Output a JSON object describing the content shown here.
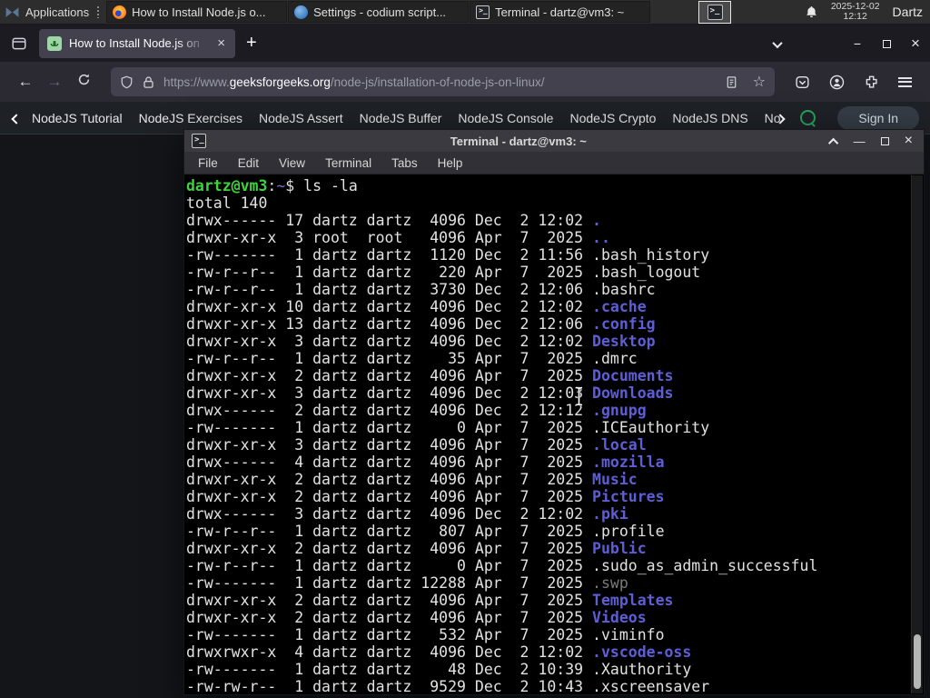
{
  "taskbar": {
    "applications_label": "Applications",
    "windows": [
      {
        "icon": "firefox",
        "title": "How to Install Node.js o..."
      },
      {
        "icon": "codium",
        "title": "Settings - codium script..."
      },
      {
        "icon": "terminal",
        "title": "Terminal - dartz@vm3: ~"
      }
    ],
    "clock": {
      "date": "2025-12-02",
      "time": "12:12"
    },
    "user": "Dartz"
  },
  "browser": {
    "tab": {
      "title": "How to Install Node.js on"
    },
    "new_tab_label": "+",
    "url": {
      "prefix": "https://www.",
      "domain": "geeksforgeeks.org",
      "path": "/node-js/installation-of-node-js-on-linux/"
    }
  },
  "site_nav": {
    "items": [
      "NodeJS Tutorial",
      "NodeJS Exercises",
      "NodeJS Assert",
      "NodeJS Buffer",
      "NodeJS Console",
      "NodeJS Crypto",
      "NodeJS DNS",
      "Node"
    ],
    "sign_in_label": "Sign In"
  },
  "terminal_window": {
    "title": "Terminal - dartz@vm3: ~",
    "menu_items": [
      "File",
      "Edit",
      "View",
      "Terminal",
      "Tabs",
      "Help"
    ],
    "prompt": {
      "user_host": "dartz@vm3",
      "separator": ":",
      "cwd": "~",
      "prompt_char": "$",
      "command": "ls -la"
    },
    "total_line": "total 140",
    "listing": [
      {
        "pre": "drwx------ 17 dartz dartz  4096 Dec  2 12:02 ",
        "name": ".",
        "type": "dir"
      },
      {
        "pre": "drwxr-xr-x  3 root  root   4096 Apr  7  2025 ",
        "name": "..",
        "type": "dir"
      },
      {
        "pre": "-rw-------  1 dartz dartz  1120 Dec  2 11:56 ",
        "name": ".bash_history",
        "type": "file"
      },
      {
        "pre": "-rw-r--r--  1 dartz dartz   220 Apr  7  2025 ",
        "name": ".bash_logout",
        "type": "file"
      },
      {
        "pre": "-rw-r--r--  1 dartz dartz  3730 Dec  2 12:06 ",
        "name": ".bashrc",
        "type": "file"
      },
      {
        "pre": "drwxr-xr-x 10 dartz dartz  4096 Dec  2 12:02 ",
        "name": ".cache",
        "type": "dir"
      },
      {
        "pre": "drwxr-xr-x 13 dartz dartz  4096 Dec  2 12:06 ",
        "name": ".config",
        "type": "dir"
      },
      {
        "pre": "drwxr-xr-x  3 dartz dartz  4096 Dec  2 12:02 ",
        "name": "Desktop",
        "type": "dir"
      },
      {
        "pre": "-rw-r--r--  1 dartz dartz    35 Apr  7  2025 ",
        "name": ".dmrc",
        "type": "file"
      },
      {
        "pre": "drwxr-xr-x  2 dartz dartz  4096 Apr  7  2025 ",
        "name": "Documents",
        "type": "dir"
      },
      {
        "pre": "drwxr-xr-x  3 dartz dartz  4096 Dec  2 12:03 ",
        "name": "Downloads",
        "type": "dir"
      },
      {
        "pre": "drwx------  2 dartz dartz  4096 Dec  2 12:12 ",
        "name": ".gnupg",
        "type": "dir"
      },
      {
        "pre": "-rw-------  1 dartz dartz     0 Apr  7  2025 ",
        "name": ".ICEauthority",
        "type": "file"
      },
      {
        "pre": "drwxr-xr-x  3 dartz dartz  4096 Apr  7  2025 ",
        "name": ".local",
        "type": "dir"
      },
      {
        "pre": "drwx------  4 dartz dartz  4096 Apr  7  2025 ",
        "name": ".mozilla",
        "type": "dir"
      },
      {
        "pre": "drwxr-xr-x  2 dartz dartz  4096 Apr  7  2025 ",
        "name": "Music",
        "type": "dir"
      },
      {
        "pre": "drwxr-xr-x  2 dartz dartz  4096 Apr  7  2025 ",
        "name": "Pictures",
        "type": "dir"
      },
      {
        "pre": "drwx------  3 dartz dartz  4096 Dec  2 12:02 ",
        "name": ".pki",
        "type": "dir"
      },
      {
        "pre": "-rw-r--r--  1 dartz dartz   807 Apr  7  2025 ",
        "name": ".profile",
        "type": "file"
      },
      {
        "pre": "drwxr-xr-x  2 dartz dartz  4096 Apr  7  2025 ",
        "name": "Public",
        "type": "dir"
      },
      {
        "pre": "-rw-r--r--  1 dartz dartz     0 Apr  7  2025 ",
        "name": ".sudo_as_admin_successful",
        "type": "file"
      },
      {
        "pre": "-rw-------  1 dartz dartz 12288 Apr  7  2025 ",
        "name": ".swp",
        "type": "dim"
      },
      {
        "pre": "drwxr-xr-x  2 dartz dartz  4096 Apr  7  2025 ",
        "name": "Templates",
        "type": "dir"
      },
      {
        "pre": "drwxr-xr-x  2 dartz dartz  4096 Apr  7  2025 ",
        "name": "Videos",
        "type": "dir"
      },
      {
        "pre": "-rw-------  1 dartz dartz   532 Apr  7  2025 ",
        "name": ".viminfo",
        "type": "file"
      },
      {
        "pre": "drwxrwxr-x  4 dartz dartz  4096 Dec  2 12:02 ",
        "name": ".vscode-oss",
        "type": "dir"
      },
      {
        "pre": "-rw-------  1 dartz dartz    48 Dec  2 10:39 ",
        "name": ".Xauthority",
        "type": "file"
      },
      {
        "pre": "-rw-rw-r--  1 dartz dartz  9529 Dec  2 10:43 ",
        "name": ".xscreensaver",
        "type": "file"
      }
    ]
  },
  "colors": {
    "dir_blue": "#5e5ed6",
    "prompt_green": "#3fd23f",
    "terminal_bg": "#000000",
    "gfg_green": "#2f8d46",
    "panel_bg": "#2d2d2d",
    "toolbar_bg": "#2b2a33"
  }
}
